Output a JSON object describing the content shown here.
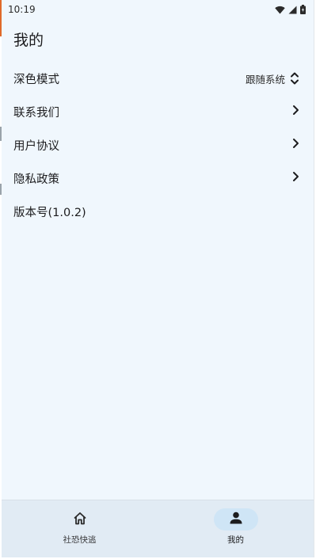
{
  "status_bar": {
    "time": "10:19",
    "icons": [
      "wifi-icon",
      "cell-signal-icon",
      "battery-icon"
    ]
  },
  "page": {
    "title": "我的"
  },
  "settings": [
    {
      "label": "深色模式",
      "value": "跟随系统",
      "control": "unfold-icon"
    },
    {
      "label": "联系我们",
      "control": "chevron-right-icon"
    },
    {
      "label": "用户协议",
      "control": "chevron-right-icon"
    },
    {
      "label": "隐私政策",
      "control": "chevron-right-icon"
    },
    {
      "label": "版本号(1.0.2)"
    }
  ],
  "bottom_nav": {
    "items": [
      {
        "label": "社恐快逃",
        "icon": "home-icon",
        "active": false
      },
      {
        "label": "我的",
        "icon": "person-icon",
        "active": true
      }
    ]
  },
  "colors": {
    "background": "#f0f7fd",
    "nav_background": "#e1ebf4",
    "active_indicator": "#cfe5f6",
    "text": "#1c1c1e"
  }
}
